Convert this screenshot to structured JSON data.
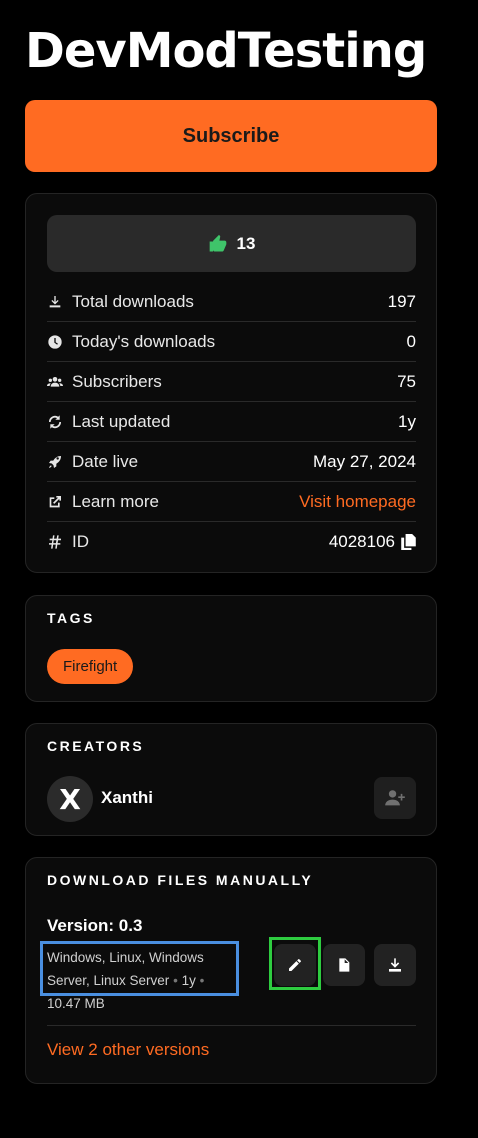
{
  "header": {
    "title": "DevModTesting"
  },
  "subscribe": {
    "label": "Subscribe"
  },
  "stats": {
    "likes": "13",
    "rows": [
      {
        "label": "Total downloads",
        "value": "197",
        "icon": "download-icon"
      },
      {
        "label": "Today's downloads",
        "value": "0",
        "icon": "clock-icon"
      },
      {
        "label": "Subscribers",
        "value": "75",
        "icon": "users-icon"
      },
      {
        "label": "Last updated",
        "value": "1y",
        "icon": "refresh-icon"
      },
      {
        "label": "Date live",
        "value": "May 27, 2024",
        "icon": "rocket-icon"
      },
      {
        "label": "Learn more",
        "value": "Visit homepage",
        "icon": "external-link-icon"
      },
      {
        "label": "ID",
        "value": "4028106",
        "icon": "hash-icon"
      }
    ]
  },
  "tags": {
    "heading": "TAGS",
    "items": [
      "Firefight"
    ]
  },
  "creators": {
    "heading": "CREATORS",
    "items": [
      {
        "name": "Xanthi",
        "initial": "X"
      }
    ]
  },
  "downloads": {
    "heading": "DOWNLOAD FILES MANUALLY",
    "version": "Version: 0.3",
    "platforms_line1": "Windows, Linux, Windows",
    "platforms_line2": "Server, Linux Server",
    "age": "1y",
    "size": "10.47 MB",
    "separator": "•",
    "other_versions": "View 2 other versions"
  },
  "colors": {
    "accent": "#ff6b22",
    "like": "#3fc46a",
    "highlight_blue": "#4a8fe0",
    "highlight_green": "#2ecc40"
  }
}
